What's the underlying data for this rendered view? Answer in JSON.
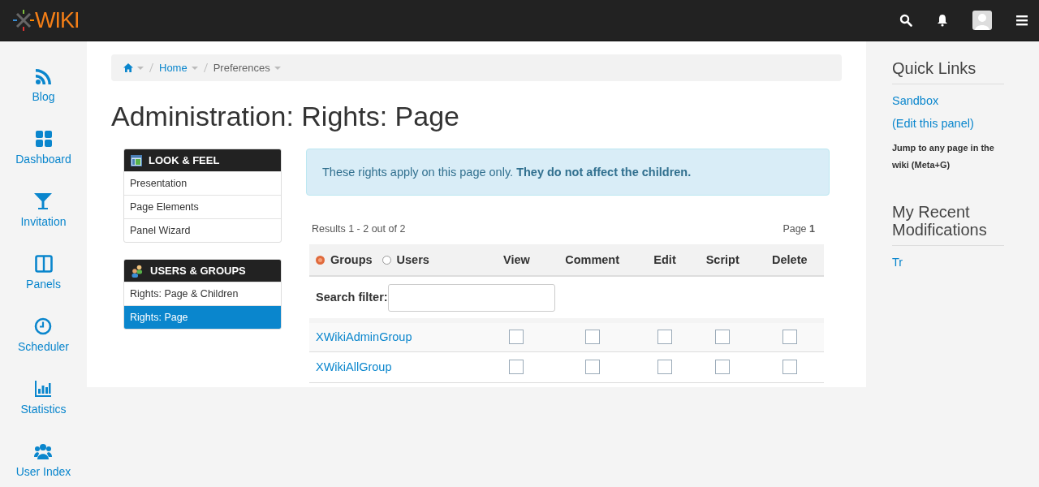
{
  "topbar": {
    "logo": "WIKI"
  },
  "sidebar": {
    "items": [
      {
        "label": "Blog"
      },
      {
        "label": "Dashboard"
      },
      {
        "label": "Invitation"
      },
      {
        "label": "Panels"
      },
      {
        "label": "Scheduler"
      },
      {
        "label": "Statistics"
      },
      {
        "label": "User Index"
      }
    ]
  },
  "breadcrumb": [
    "Home",
    "Preferences"
  ],
  "title": "Administration: Rights: Page",
  "admin_menu": [
    {
      "heading": "LOOK & FEEL",
      "items": [
        {
          "label": "Presentation",
          "selected": false
        },
        {
          "label": "Page Elements",
          "selected": false
        },
        {
          "label": "Panel Wizard",
          "selected": false
        }
      ]
    },
    {
      "heading": "USERS & GROUPS",
      "items": [
        {
          "label": "Rights: Page & Children",
          "selected": false
        },
        {
          "label": "Rights: Page",
          "selected": true
        }
      ]
    }
  ],
  "notice": "These rights apply on this page only. **They do not affect the children.**",
  "results": {
    "summary": "Results 1 - 2 out of 2",
    "page_label": "Page",
    "page_number": "1"
  },
  "table": {
    "scope": [
      {
        "label": "Groups",
        "selected": true
      },
      {
        "label": "Users",
        "selected": false
      }
    ],
    "columns": [
      "View",
      "Comment",
      "Edit",
      "Script",
      "Delete"
    ],
    "filter_label": "Search filter:",
    "rows": [
      {
        "name": "XWikiAdminGroup",
        "rights": [
          false,
          false,
          false,
          false,
          false
        ]
      },
      {
        "name": "XWikiAllGroup",
        "rights": [
          false,
          false,
          false,
          false,
          false
        ]
      }
    ]
  },
  "right_panel": {
    "quick_links": {
      "title": "Quick Links",
      "links": [
        "Sandbox",
        "(Edit this panel)"
      ],
      "hint": "Jump to any page in the wiki (Meta+G)"
    },
    "recent": {
      "title": "My Recent Modifications",
      "links": [
        "Tr"
      ]
    }
  }
}
